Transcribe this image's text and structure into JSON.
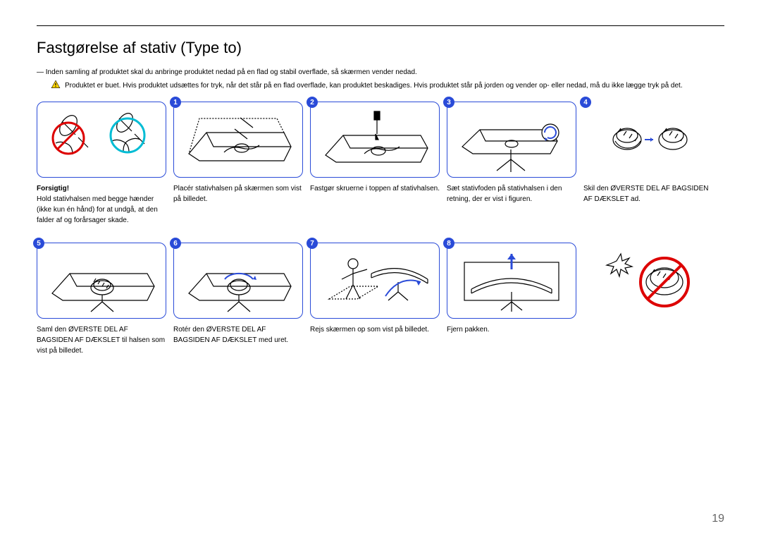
{
  "title": "Fastgørelse af stativ (Type to)",
  "intro": "Inden samling af produktet skal du anbringe produktet nedad på en flad og stabil overflade, så skærmen vender nedad.",
  "warning": "Produktet er buet. Hvis produktet udsættes for tryk, når det står på en flad overflade, kan produktet beskadiges. Hvis produktet står på jorden og vender op- eller nedad, må du ikke lægge tryk på det.",
  "row1": {
    "c0": {
      "strong": "Forsigtig!",
      "text": "Hold stativhalsen med begge hænder (ikke kun én hånd) for at undgå, at den falder af og forårsager skade."
    },
    "c1": {
      "num": "1",
      "text": "Placér stativhalsen på skærmen som vist på billedet."
    },
    "c2": {
      "num": "2",
      "text": "Fastgør skruerne i toppen af stativhalsen."
    },
    "c3": {
      "num": "3",
      "text": "Sæt stativfoden på stativhalsen i den retning, der er vist i figuren."
    },
    "c4": {
      "num": "4",
      "text": "Skil den ØVERSTE DEL AF BAGSIDEN AF DÆKSLET ad."
    }
  },
  "row2": {
    "c0": {
      "num": "5",
      "text": "Saml den ØVERSTE DEL AF BAGSIDEN AF DÆKSLET til halsen som vist på billedet."
    },
    "c1": {
      "num": "6",
      "text": "Rotér den ØVERSTE DEL AF BAGSIDEN AF DÆKSLET med uret."
    },
    "c2": {
      "num": "7",
      "text": "Rejs skærmen op som vist på billedet."
    },
    "c3": {
      "num": "8",
      "text": "Fjern pakken."
    },
    "c4": {
      "text": ""
    }
  },
  "page_number": "19"
}
